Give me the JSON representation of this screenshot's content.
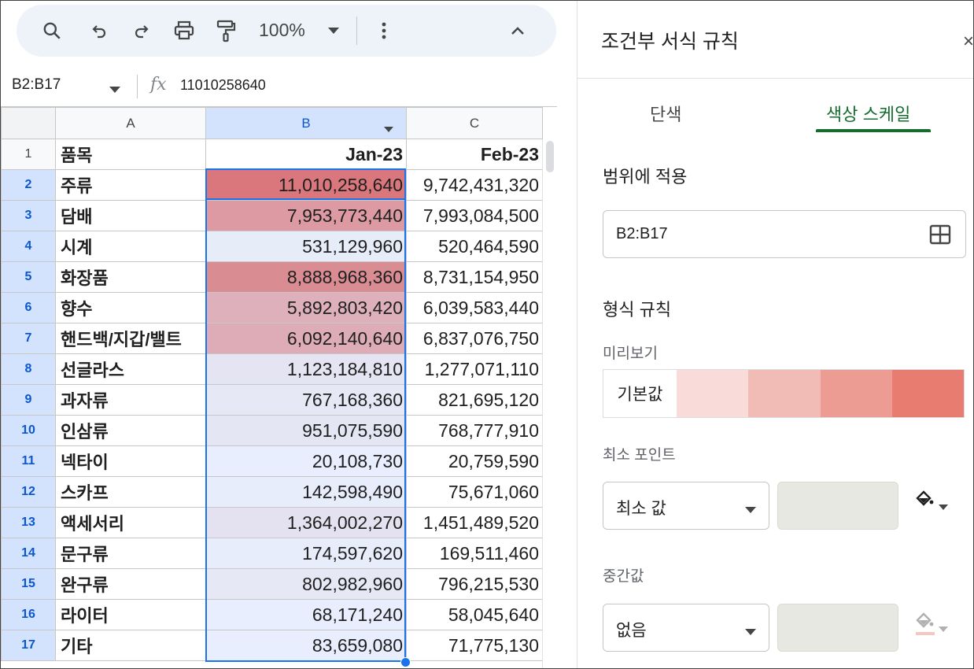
{
  "toolbar": {
    "zoom": "100%",
    "icons": [
      "search-icon",
      "undo-icon",
      "redo-icon",
      "print-icon",
      "paint-format-icon",
      "chevron-down-icon",
      "more-vert-icon",
      "chevron-up-icon"
    ]
  },
  "formula_bar": {
    "name_box": "B2:B17",
    "fx": "fx",
    "value": "11010258640"
  },
  "sheet": {
    "columns": [
      "A",
      "B",
      "C"
    ],
    "header_row": {
      "row": "1",
      "a": "품목",
      "b": "Jan-23",
      "c": "Feb-23"
    },
    "rows": [
      {
        "row": "2",
        "a": "주류",
        "b": "11,010,258,640",
        "c": "9,742,431,320",
        "b_color": "#d9777c"
      },
      {
        "row": "3",
        "a": "담배",
        "b": "7,953,773,440",
        "c": "7,993,084,500",
        "b_color": "#dd9aa2"
      },
      {
        "row": "4",
        "a": "시계",
        "b": "531,129,960",
        "c": "520,464,590",
        "b_color": "#e7ecf9"
      },
      {
        "row": "5",
        "a": "화장품",
        "b": "8,888,968,360",
        "c": "8,731,154,950",
        "b_color": "#da8c93"
      },
      {
        "row": "6",
        "a": "향수",
        "b": "5,892,803,420",
        "c": "6,039,583,440",
        "b_color": "#deb0bc"
      },
      {
        "row": "7",
        "a": "핸드백/지갑/밸트",
        "b": "6,092,140,640",
        "c": "6,837,076,750",
        "b_color": "#deacb6"
      },
      {
        "row": "8",
        "a": "선글라스",
        "b": "1,123,184,810",
        "c": "1,277,071,110",
        "b_color": "#e4e4f2"
      },
      {
        "row": "9",
        "a": "과자류",
        "b": "767,168,360",
        "c": "821,695,120",
        "b_color": "#e6e8f6"
      },
      {
        "row": "10",
        "a": "인삼류",
        "b": "951,075,590",
        "c": "768,777,910",
        "b_color": "#e5e6f4"
      },
      {
        "row": "11",
        "a": "넥타이",
        "b": "20,108,730",
        "c": "20,759,590",
        "b_color": "#e8eefd"
      },
      {
        "row": "12",
        "a": "스카프",
        "b": "142,598,490",
        "c": "75,671,060",
        "b_color": "#e8edfc"
      },
      {
        "row": "13",
        "a": "액세서리",
        "b": "1,364,002,270",
        "c": "1,451,489,520",
        "b_color": "#e4e2f0"
      },
      {
        "row": "14",
        "a": "문구류",
        "b": "174,597,620",
        "c": "169,511,460",
        "b_color": "#e8edfc"
      },
      {
        "row": "15",
        "a": "완구류",
        "b": "802,982,960",
        "c": "796,215,530",
        "b_color": "#e6e8f6"
      },
      {
        "row": "16",
        "a": "라이터",
        "b": "68,171,240",
        "c": "58,045,640",
        "b_color": "#e8eefd"
      },
      {
        "row": "17",
        "a": "기타",
        "b": "83,659,080",
        "c": "71,775,130",
        "b_color": "#e8eefd"
      }
    ]
  },
  "panel": {
    "title": "조건부 서식 규칙",
    "close": "×",
    "tabs": {
      "single": "단색",
      "scale": "색상 스케일"
    },
    "apply_range_label": "범위에 적용",
    "range_value": "B2:B17",
    "format_rules_label": "형식 규칙",
    "preview_label": "미리보기",
    "preview_default": "기본값",
    "preview_colors": [
      "#f9dcd9",
      "#f2bcb6",
      "#ed9c93",
      "#e87c71"
    ],
    "min_point_label": "최소 포인트",
    "min_point_value": "최소 값",
    "midpoint_label": "중간값",
    "midpoint_value": "없음",
    "value_box_color": "#e8e8e3"
  }
}
